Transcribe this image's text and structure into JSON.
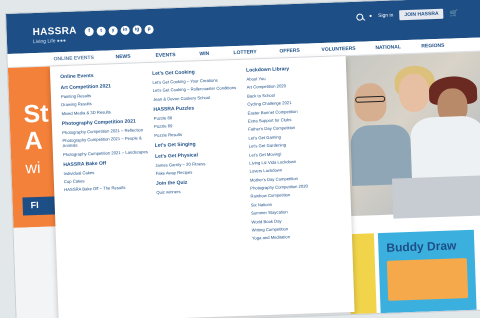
{
  "brand": {
    "name": "HASSRA",
    "tagline": "Living Life ●●●"
  },
  "socials": [
    "f",
    "t",
    "y",
    "in",
    "ig",
    "p"
  ],
  "toolbar": {
    "signin": "Sign in",
    "join": "JOIN HASSRA"
  },
  "nav": [
    "ONLINE EVENTS",
    "NEWS",
    "EVENTS",
    "WIN",
    "LOTTERY",
    "OFFERS",
    "VOLUNTEERS",
    "NATIONAL",
    "REGIONS"
  ],
  "hero": {
    "line1": "St",
    "line2": "A",
    "line3": "wi",
    "button": "FI"
  },
  "menu": {
    "col1": [
      {
        "h": "Online Events"
      },
      {
        "h": "Art Competition 2021"
      },
      {
        "i": "Painting Results"
      },
      {
        "i": "Drawing Results"
      },
      {
        "i": "Mixed Media & 3D Results"
      },
      {
        "h": "Photography Competition 2021"
      },
      {
        "i": "Photography Competition 2021 – Reflection"
      },
      {
        "i": "Photography Competition 2021 – People & Animals"
      },
      {
        "i": "Photography Competition 2021 – Landscapes"
      },
      {
        "h": "HASSRA Bake Off"
      },
      {
        "i": "Individual Cakes"
      },
      {
        "i": "Cup Cakes"
      },
      {
        "i": "HASSRA Bake Off – The Results"
      }
    ],
    "col2": [
      {
        "h": "Let's Get Cooking"
      },
      {
        "i": "Let's Get Cooking – Your Creations"
      },
      {
        "i": "Let's Get Cooking – Rollercoaster Conditions"
      },
      {
        "i": "Jean & Devon Cookery School"
      },
      {
        "h": "HASSRA Puzzles"
      },
      {
        "i": "Puzzle 88"
      },
      {
        "i": "Puzzle 89"
      },
      {
        "i": "Puzzle Results"
      },
      {
        "h": "Let's Get Singing"
      },
      {
        "h": "Let's Get Physical"
      },
      {
        "i": "James Garrity – 20 Fitness"
      },
      {
        "i": "Fake Away Recipes"
      },
      {
        "h": "Join the Quiz"
      },
      {
        "i": "Quiz winners"
      }
    ],
    "col3": [
      {
        "h": "Lockdown Library"
      },
      {
        "i": "About You"
      },
      {
        "i": "Art Competition 2020"
      },
      {
        "i": "Back to School"
      },
      {
        "i": "Cycling Challenge 2021"
      },
      {
        "i": "Easter Bonnet Competition"
      },
      {
        "i": "Extra Support for Clubs"
      },
      {
        "i": "Father's Day Competition"
      },
      {
        "i": "Let's Get Gaming"
      },
      {
        "i": "Let's Get Gardening"
      },
      {
        "i": "Let's Get Moving!"
      },
      {
        "i": "Living Liz Vida Lockdown"
      },
      {
        "i": "Lovers Lockdown"
      },
      {
        "i": "Mother's Day Competition"
      },
      {
        "i": "Photography Competition 2020"
      },
      {
        "i": "Rainbow Competition"
      },
      {
        "i": "Six Nations"
      },
      {
        "i": "Summer Staycation"
      },
      {
        "i": "World Book Day"
      },
      {
        "i": "Writing Competition"
      },
      {
        "i": "Yoga and Meditation"
      }
    ]
  },
  "cards": {
    "buddy": "Buddy Draw"
  }
}
